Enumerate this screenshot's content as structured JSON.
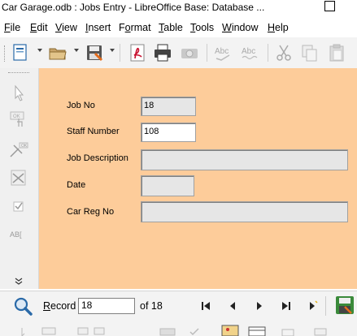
{
  "window": {
    "title": "Car Garage.odb : Jobs Entry - LibreOffice Base: Database ..."
  },
  "menu": [
    {
      "accel": "F",
      "rest": "ile"
    },
    {
      "accel": "E",
      "rest": "dit"
    },
    {
      "accel": "V",
      "rest": "iew"
    },
    {
      "accel": "I",
      "rest": "nsert"
    },
    {
      "accel": "F",
      "rest": "ormat",
      "accel_after": "o",
      "prefix": "F"
    },
    {
      "accel": "T",
      "rest": "able"
    },
    {
      "accel": "T",
      "rest": "ools"
    },
    {
      "accel": "W",
      "rest": "indow"
    },
    {
      "accel": "H",
      "rest": "elp"
    }
  ],
  "menu_labels": [
    "File",
    "Edit",
    "View",
    "Insert",
    "Format",
    "Table",
    "Tools",
    "Window",
    "Help"
  ],
  "left_toolbar": {
    "abc_label": "AB["
  },
  "form": {
    "job_no_label": "Job No",
    "job_no_value": "18",
    "staff_number_label": "Staff Number",
    "staff_number_value": "108",
    "job_description_label": "Job Description",
    "job_description_value": "",
    "date_label": "Date",
    "date_value": "",
    "car_reg_label": "Car Reg No",
    "car_reg_value": ""
  },
  "navigation": {
    "record_label": "Record",
    "record_value": "18",
    "of_label": "of 18"
  },
  "colors": {
    "form_bg": "#fdcc9a",
    "toolbar_bg": "#f3f3f3",
    "field_bg": "#e6e6e6"
  }
}
